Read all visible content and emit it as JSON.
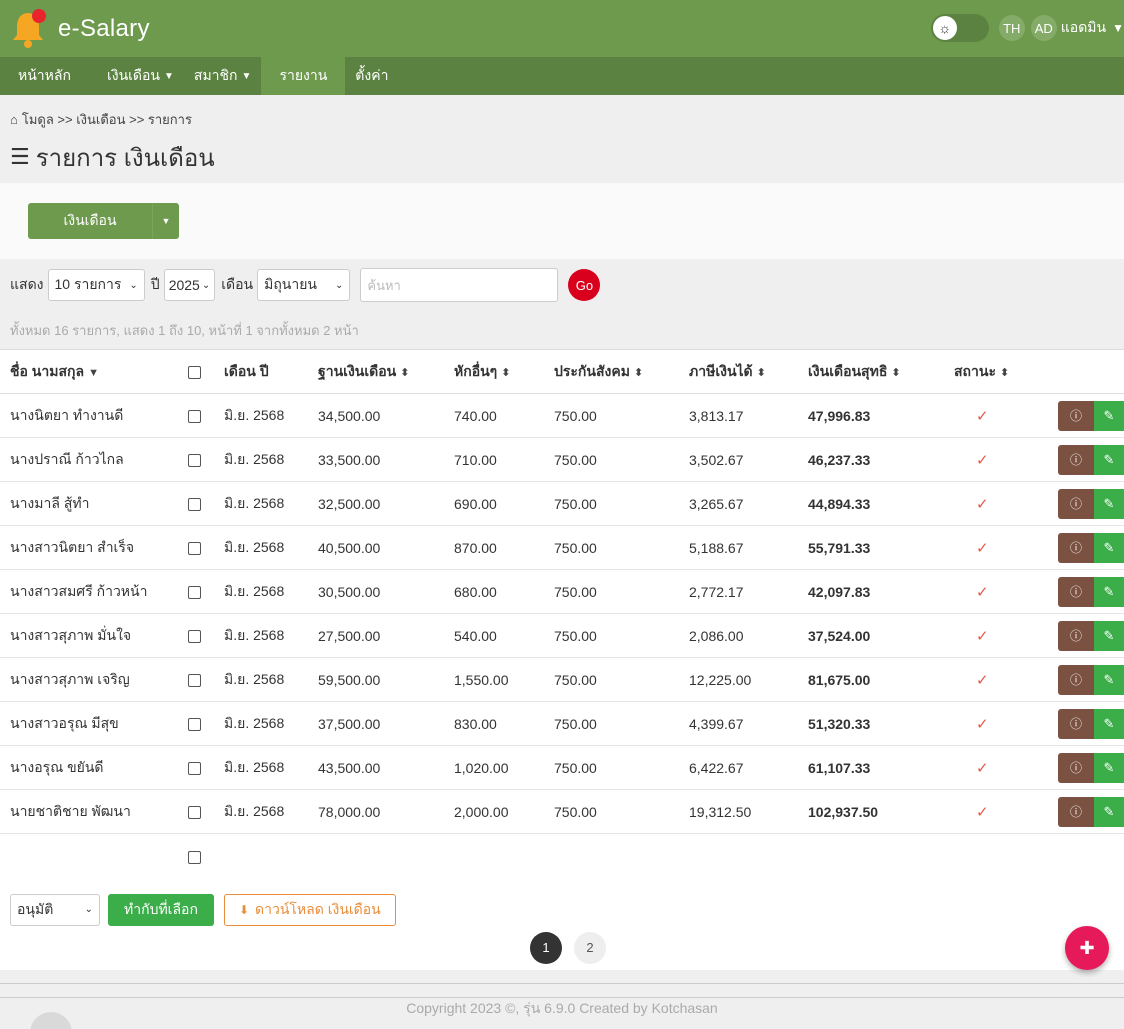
{
  "app": {
    "title": "e-Salary"
  },
  "topbar": {
    "theme_icon": "sun-icon",
    "lang": "TH",
    "avatar": "AD",
    "username": "แอดมิน"
  },
  "nav": {
    "home": "หน้าหลัก",
    "salary": "เงินเดือน",
    "members": "สมาชิก",
    "report": "รายงาน",
    "settings": "ตั้งค่า"
  },
  "breadcrumb": {
    "text": "โมดูล >> เงินเดือน >> รายการ"
  },
  "page": {
    "title": "รายการ เงินเดือน"
  },
  "actions": {
    "salary_button": "เงินเดือน"
  },
  "filters": {
    "show_label": "แสดง",
    "show_value": "10 รายการ",
    "year_label": "ปี",
    "year_value": "2025",
    "month_label": "เดือน",
    "month_value": "มิถุนายน",
    "search_placeholder": "ค้นหา",
    "go_label": "Go"
  },
  "summary": "ทั้งหมด 16 รายการ, แสดง 1 ถึง 10, หน้าที่ 1 จากทั้งหมด 2 หน้า",
  "table": {
    "headers": {
      "name": "ชื่อ นามสกุล",
      "month": "เดือน ปี",
      "base": "ฐานเงินเดือน",
      "deduct": "หักอื่นๆ",
      "social": "ประกันสังคม",
      "tax": "ภาษีเงินได้",
      "net": "เงินเดือนสุทธิ",
      "status": "สถานะ"
    },
    "rows": [
      {
        "name": "นางนิตยา ทำงานดี",
        "month": "มิ.ย. 2568",
        "base": "34,500.00",
        "deduct": "740.00",
        "social": "750.00",
        "tax": "3,813.17",
        "net": "47,996.83"
      },
      {
        "name": "นางปราณี ก้าวไกล",
        "month": "มิ.ย. 2568",
        "base": "33,500.00",
        "deduct": "710.00",
        "social": "750.00",
        "tax": "3,502.67",
        "net": "46,237.33"
      },
      {
        "name": "นางมาลี สู้ทำ",
        "month": "มิ.ย. 2568",
        "base": "32,500.00",
        "deduct": "690.00",
        "social": "750.00",
        "tax": "3,265.67",
        "net": "44,894.33"
      },
      {
        "name": "นางสาวนิตยา สำเร็จ",
        "month": "มิ.ย. 2568",
        "base": "40,500.00",
        "deduct": "870.00",
        "social": "750.00",
        "tax": "5,188.67",
        "net": "55,791.33"
      },
      {
        "name": "นางสาวสมศรี ก้าวหน้า",
        "month": "มิ.ย. 2568",
        "base": "30,500.00",
        "deduct": "680.00",
        "social": "750.00",
        "tax": "2,772.17",
        "net": "42,097.83"
      },
      {
        "name": "นางสาวสุภาพ มั่นใจ",
        "month": "มิ.ย. 2568",
        "base": "27,500.00",
        "deduct": "540.00",
        "social": "750.00",
        "tax": "2,086.00",
        "net": "37,524.00"
      },
      {
        "name": "นางสาวสุภาพ เจริญ",
        "month": "มิ.ย. 2568",
        "base": "59,500.00",
        "deduct": "1,550.00",
        "social": "750.00",
        "tax": "12,225.00",
        "net": "81,675.00"
      },
      {
        "name": "นางสาวอรุณ มีสุข",
        "month": "มิ.ย. 2568",
        "base": "37,500.00",
        "deduct": "830.00",
        "social": "750.00",
        "tax": "4,399.67",
        "net": "51,320.33"
      },
      {
        "name": "นางอรุณ ขยันดี",
        "month": "มิ.ย. 2568",
        "base": "43,500.00",
        "deduct": "1,020.00",
        "social": "750.00",
        "tax": "6,422.67",
        "net": "61,107.33"
      },
      {
        "name": "นายชาติชาย พัฒนา",
        "month": "มิ.ย. 2568",
        "base": "78,000.00",
        "deduct": "2,000.00",
        "social": "750.00",
        "tax": "19,312.50",
        "net": "102,937.50"
      }
    ]
  },
  "bulk": {
    "action_value": "อนุมัติ",
    "apply_label": "ทำกับที่เลือก",
    "download_label": "ดาวน์โหลด เงินเดือน"
  },
  "pagination": {
    "pages": [
      "1",
      "2"
    ],
    "current": "1"
  },
  "footer": {
    "copyright": "Copyright 2023 ©, รุ่น 6.9.0 Created by Kotchasan"
  },
  "colors": {
    "header_green": "#6e9a4e",
    "nav_green": "#5b8240",
    "go_red": "#d8001d",
    "fab_pink": "#e6195a",
    "info_brown": "#7b5142",
    "edit_green": "#3bae4a",
    "download_orange": "#e98d3a"
  }
}
